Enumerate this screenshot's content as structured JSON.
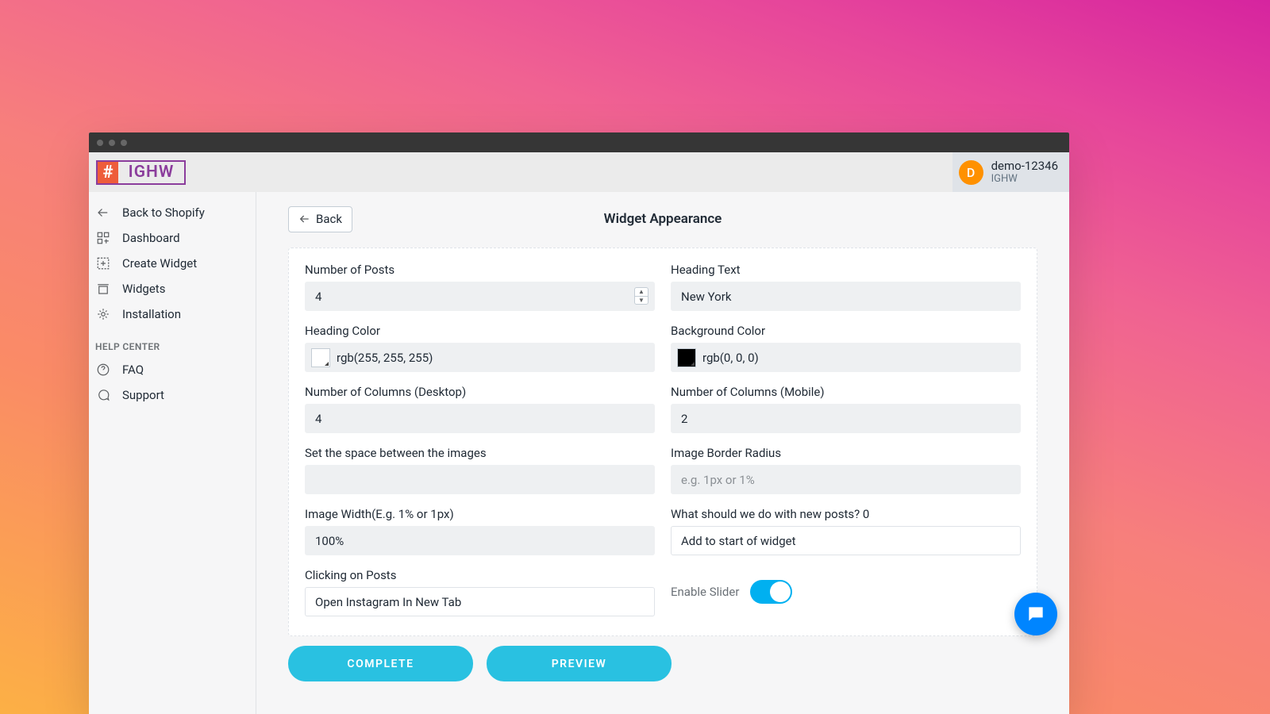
{
  "logo": {
    "hash": "#",
    "text": "IGHW"
  },
  "account": {
    "name": "demo-12346",
    "sub": "IGHW",
    "avatar_letter": "D"
  },
  "sidebar": {
    "items": [
      "Back to Shopify",
      "Dashboard",
      "Create Widget",
      "Widgets",
      "Installation"
    ],
    "help_header": "HELP CENTER",
    "help_items": [
      "FAQ",
      "Support"
    ]
  },
  "page": {
    "back_label": "Back",
    "title": "Widget Appearance"
  },
  "form": {
    "number_of_posts": {
      "label": "Number of Posts",
      "value": "4"
    },
    "heading_text": {
      "label": "Heading Text",
      "value": "New York"
    },
    "heading_color": {
      "label": "Heading Color",
      "value": "rgb(255, 255, 255)",
      "swatch": "#ffffff"
    },
    "background_color": {
      "label": "Background Color",
      "value": "rgb(0, 0, 0)",
      "swatch": "#000000"
    },
    "cols_desktop": {
      "label": "Number of Columns (Desktop)",
      "value": "4"
    },
    "cols_mobile": {
      "label": "Number of Columns (Mobile)",
      "value": "2"
    },
    "image_space": {
      "label": "Set the space between the images",
      "value": ""
    },
    "border_radius": {
      "label": "Image Border Radius",
      "value": "",
      "placeholder": "e.g. 1px or 1%"
    },
    "image_width": {
      "label": "Image Width(E.g. 1% or 1px)",
      "value": "100%"
    },
    "new_posts": {
      "label": "What should we do with new posts? 0",
      "value": "Add to start of widget"
    },
    "clicking": {
      "label": "Clicking on Posts",
      "value": "Open Instagram In New Tab"
    },
    "enable_slider": {
      "label": "Enable Slider",
      "value": true
    }
  },
  "buttons": {
    "complete": "COMPLETE",
    "preview": "PREVIEW"
  }
}
